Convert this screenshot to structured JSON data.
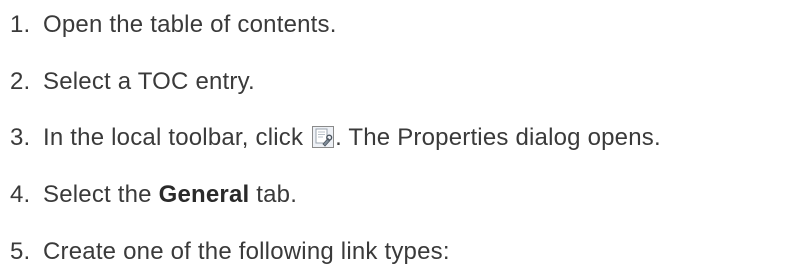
{
  "steps": [
    {
      "number": "1.",
      "text": "Open the table of contents."
    },
    {
      "number": "2.",
      "text": "Select a TOC entry."
    },
    {
      "number": "3.",
      "text_before": "In the local toolbar, click ",
      "icon": "properties-icon",
      "text_after": ". The Properties dialog opens."
    },
    {
      "number": "4.",
      "text_before": "Select the ",
      "bold": "General",
      "text_after": " tab."
    },
    {
      "number": "5.",
      "text": "Create one of the following link types:"
    }
  ]
}
